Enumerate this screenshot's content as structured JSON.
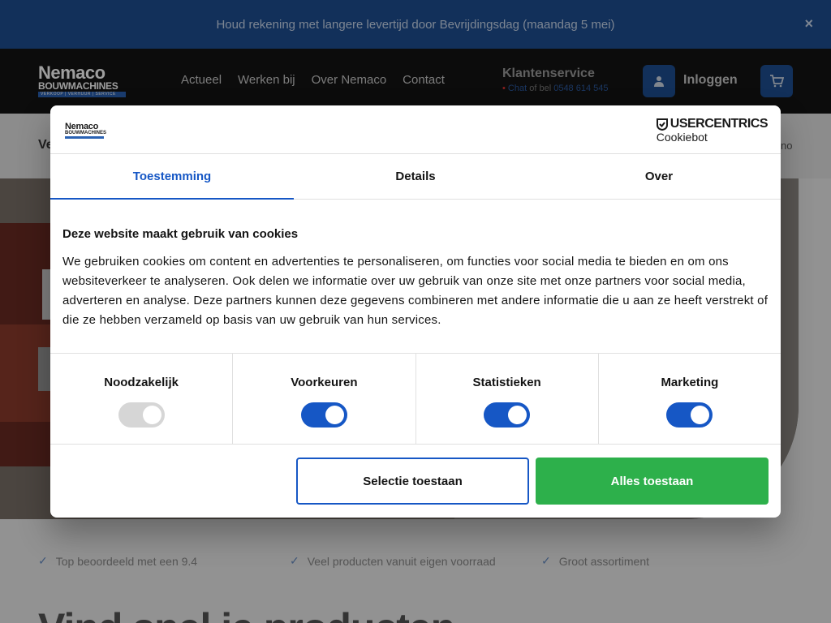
{
  "announcement": {
    "text": "Houd rekening met langere levertijd door Bevrijdingsdag (maandag 5 mei)",
    "close": "×"
  },
  "header": {
    "logo": {
      "main": "Nemaco",
      "sub": "BOUWMACHINES",
      "tag": "VERKOOP  |  VERHUUR  |  SERVICE"
    },
    "nav": [
      "Actueel",
      "Werken bij",
      "Over Nemaco",
      "Contact"
    ],
    "service": {
      "title": "Klantenservice",
      "chat": "Chat",
      "middle": " of bel ",
      "phone": "0548 614 545"
    },
    "login_label": "Inloggen"
  },
  "subbar": {
    "left": "Ve",
    "right": "no"
  },
  "usps": [
    "Top beoordeeld met een 9.4",
    "Veel producten vanuit eigen voorraad",
    "Groot assortiment"
  ],
  "find_heading": "Vind snel je producten",
  "cookie_dialog": {
    "logo": {
      "main": "Nemaco",
      "sub": "BOUWMACHINES"
    },
    "brand": {
      "name": "USERCENTRICS",
      "sub": "Cookiebot"
    },
    "tabs": [
      "Toestemming",
      "Details",
      "Over"
    ],
    "active_tab": "Toestemming",
    "title": "Deze website maakt gebruik van cookies",
    "text": "We gebruiken cookies om content en advertenties te personaliseren, om functies voor social media te bieden en om ons websiteverkeer te analyseren. Ook delen we informatie over uw gebruik van onze site met onze partners voor social media, adverteren en analyse. Deze partners kunnen deze gegevens combineren met andere informatie die u aan ze heeft verstrekt of die ze hebben verzameld op basis van uw gebruik van hun services.",
    "toggles": [
      {
        "label": "Noodzakelijk",
        "on": true,
        "disabled": true
      },
      {
        "label": "Voorkeuren",
        "on": true,
        "disabled": false
      },
      {
        "label": "Statistieken",
        "on": true,
        "disabled": false
      },
      {
        "label": "Marketing",
        "on": true,
        "disabled": false
      }
    ],
    "buttons": {
      "selection": "Selectie toestaan",
      "all": "Alles toestaan"
    }
  },
  "colors": {
    "primary": "#1657c5",
    "header_blue": "#1d4e91",
    "accept_green": "#2db04b"
  }
}
